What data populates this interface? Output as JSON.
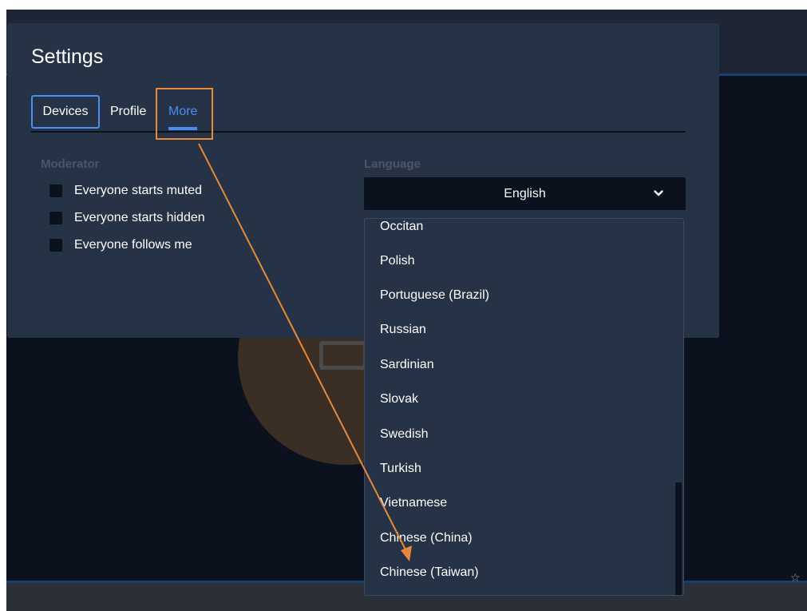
{
  "dialog": {
    "title": "Settings",
    "tabs": [
      {
        "label": "Devices"
      },
      {
        "label": "Profile"
      },
      {
        "label": "More"
      }
    ]
  },
  "moderator": {
    "label": "Moderator",
    "options": [
      {
        "label": "Everyone starts muted",
        "checked": false
      },
      {
        "label": "Everyone starts hidden",
        "checked": false
      },
      {
        "label": "Everyone follows me",
        "checked": false
      }
    ]
  },
  "language": {
    "label": "Language",
    "selected": "English",
    "options": [
      "Occitan",
      "Polish",
      "Portuguese (Brazil)",
      "Russian",
      "Sardinian",
      "Slovak",
      "Swedish",
      "Turkish",
      "Vietnamese",
      "Chinese (China)",
      "Chinese (Taiwan)"
    ]
  },
  "icons": {
    "chevron": "chevron-down-icon",
    "star": "star-icon",
    "star_glyph": "☆"
  },
  "colors": {
    "accent": "#4b8ef2",
    "annotation": "#e8883a",
    "dialog_bg": "#263246",
    "page_bg": "#0b111d"
  }
}
